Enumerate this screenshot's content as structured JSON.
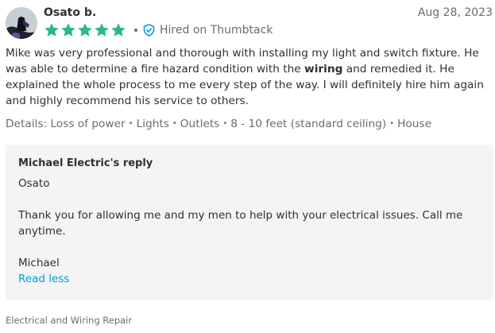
{
  "review": {
    "author": "Osato b.",
    "date": "Aug 28, 2023",
    "rating": 5,
    "star_color": "#2db783",
    "hired_label": "Hired on Thumbtack",
    "hired_icon": "shield-check-icon",
    "text_before_bold": "Mike was very professional and thorough with installing my light and switch fixture. He was able to determine a fire hazard condition with the ",
    "text_bold": "wiring",
    "text_after_bold": " and remedied it. He explained the whole process to me every step of the way. I will definitely hire him again and highly recommend his service to others.",
    "details_label": "Details:",
    "details": [
      "Loss of power",
      "Lights",
      "Outlets",
      "8 - 10 feet (standard ceiling)",
      "House"
    ]
  },
  "reply": {
    "title": "Michael Electric's reply",
    "greeting": "Osato",
    "body": "Thank you for allowing me and my men to help with your electrical issues. Call me anytime.",
    "signoff": "Michael",
    "toggle_label": "Read less",
    "link_color": "#009fd9"
  },
  "category": "Electrical and Wiring Repair"
}
